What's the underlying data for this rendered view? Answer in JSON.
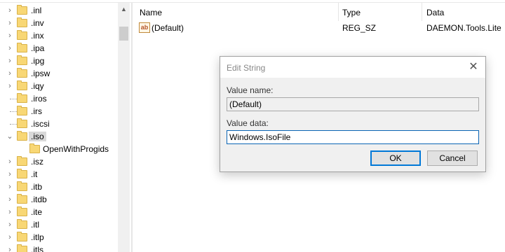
{
  "tree": {
    "items": [
      {
        "label": ".inl",
        "expander": "›"
      },
      {
        "label": ".inv",
        "expander": "›"
      },
      {
        "label": ".inx",
        "expander": "›"
      },
      {
        "label": ".ipa",
        "expander": "›"
      },
      {
        "label": ".ipg",
        "expander": "›"
      },
      {
        "label": ".ipsw",
        "expander": "›"
      },
      {
        "label": ".iqy",
        "expander": "›"
      },
      {
        "label": ".iros",
        "expander": ""
      },
      {
        "label": ".irs",
        "expander": ""
      },
      {
        "label": ".iscsi",
        "expander": ""
      },
      {
        "label": ".iso",
        "expander": "⌄"
      },
      {
        "label": "OpenWithProgids",
        "expander": ""
      },
      {
        "label": ".isz",
        "expander": "›"
      },
      {
        "label": ".it",
        "expander": "›"
      },
      {
        "label": ".itb",
        "expander": "›"
      },
      {
        "label": ".itdb",
        "expander": "›"
      },
      {
        "label": ".ite",
        "expander": "›"
      },
      {
        "label": ".itl",
        "expander": "›"
      },
      {
        "label": ".itlp",
        "expander": "›"
      },
      {
        "label": ".itls",
        "expander": "›"
      }
    ]
  },
  "list": {
    "columns": {
      "name": "Name",
      "type": "Type",
      "data": "Data"
    },
    "rows": [
      {
        "icon": "ab",
        "name": "(Default)",
        "type": "REG_SZ",
        "data": "DAEMON.Tools.Lite"
      }
    ]
  },
  "dialog": {
    "title": "Edit String",
    "close_glyph": "✕",
    "value_name_label": "Value name:",
    "value_name": "(Default)",
    "value_data_label": "Value data:",
    "value_data": "Windows.IsoFile",
    "ok_label": "OK",
    "cancel_label": "Cancel"
  },
  "colors": {
    "folder": "#f8d775",
    "accent": "#0078d7",
    "selection": "#d9d9d9"
  }
}
